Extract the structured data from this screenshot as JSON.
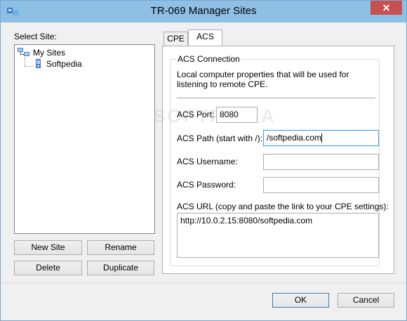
{
  "window": {
    "title": "TR-069 Manager Sites",
    "close_glyph": "✕"
  },
  "left": {
    "select_site_label": "Select Site:",
    "tree": [
      {
        "label": "My Sites",
        "icon": "network-icon"
      },
      {
        "label": "Softpedia",
        "icon": "device-icon"
      }
    ],
    "buttons": {
      "new_site": "New Site",
      "rename": "Rename",
      "delete": "Delete",
      "duplicate": "Duplicate"
    }
  },
  "tabs": [
    {
      "label": "CPE",
      "active": false
    },
    {
      "label": "ACS",
      "active": true
    }
  ],
  "acs": {
    "group_title": "ACS Connection",
    "description": "Local computer properties that will be used for listening to remote CPE.",
    "port_label": "ACS Port:",
    "port_value": "8080",
    "path_label": "ACS Path (start with /):",
    "path_value": "/softpedia.com",
    "username_label": "ACS Username:",
    "username_value": "",
    "password_label": "ACS Password:",
    "password_value": "",
    "url_label": "ACS URL (copy and paste the link to your CPE settings):",
    "url_value": "http://10.0.2.15:8080/softpedia.com"
  },
  "watermark": "SOFTPEDIA",
  "footer": {
    "ok": "OK",
    "cancel": "Cancel"
  },
  "colors": {
    "titlebar": "#8ec0e6",
    "close": "#c75050",
    "focus_border": "#3399ff"
  }
}
